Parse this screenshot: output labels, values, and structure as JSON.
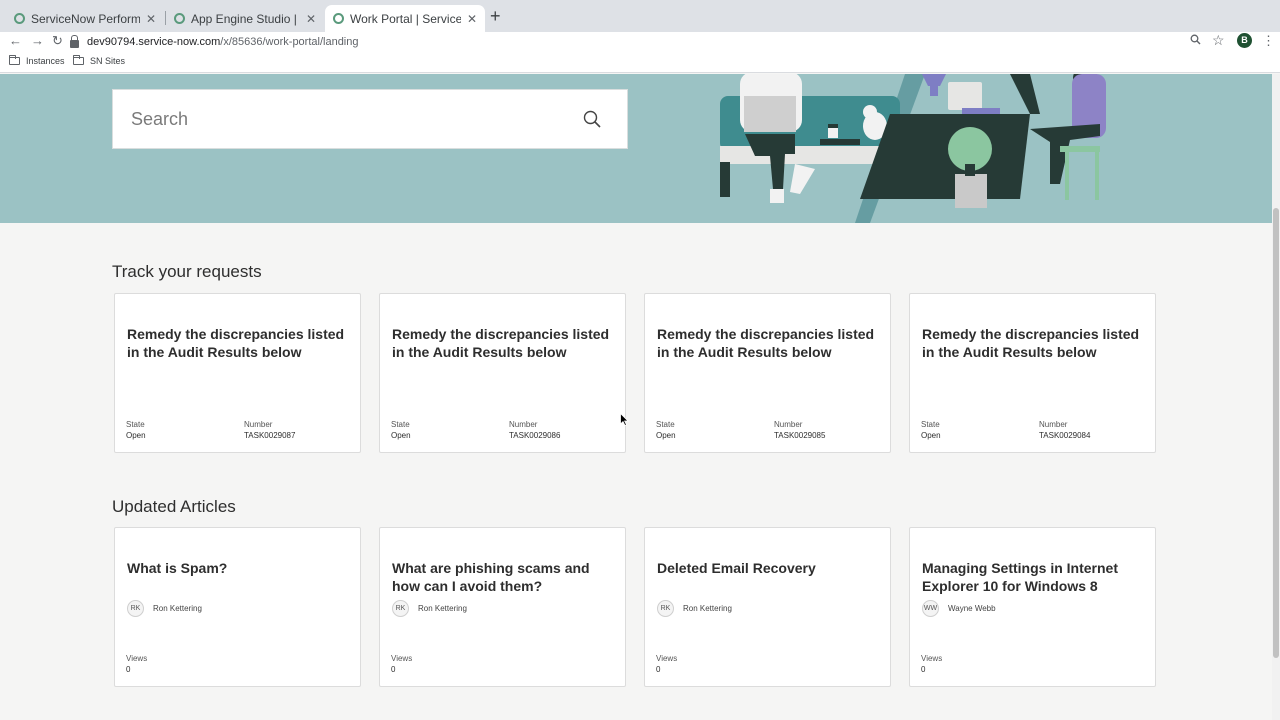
{
  "browser": {
    "tabs": [
      {
        "label": "ServiceNow Performance | Se",
        "active": false
      },
      {
        "label": "App Engine Studio | ServiceNo",
        "active": false
      },
      {
        "label": "Work Portal | ServiceNow",
        "active": true
      }
    ],
    "url_host": "dev90794.service-now.com",
    "url_path": "/x/85636/work-portal/landing",
    "profile_initial": "B",
    "bookmarks": [
      {
        "label": "Instances"
      },
      {
        "label": "SN Sites"
      }
    ]
  },
  "hero": {
    "search_placeholder": "Search",
    "background_color": "#9bc2c4"
  },
  "requests": {
    "title": "Track your requests",
    "state_label": "State",
    "number_label": "Number",
    "items": [
      {
        "title": "Remedy the discrepancies listed in the Audit Results below",
        "state": "Open",
        "number": "TASK0029087"
      },
      {
        "title": "Remedy the discrepancies listed in the Audit Results below",
        "state": "Open",
        "number": "TASK0029086"
      },
      {
        "title": "Remedy the discrepancies listed in the Audit Results below",
        "state": "Open",
        "number": "TASK0029085"
      },
      {
        "title": "Remedy the discrepancies listed in the Audit Results below",
        "state": "Open",
        "number": "TASK0029084"
      }
    ]
  },
  "articles": {
    "title": "Updated Articles",
    "views_label": "Views",
    "items": [
      {
        "title": "What is Spam?",
        "initials": "RK",
        "author": "Ron Kettering",
        "views": "0"
      },
      {
        "title": "What are phishing scams and how can I avoid them?",
        "initials": "RK",
        "author": "Ron Kettering",
        "views": "0"
      },
      {
        "title": "Deleted Email Recovery",
        "initials": "RK",
        "author": "Ron Kettering",
        "views": "0"
      },
      {
        "title": "Managing Settings in Internet Explorer 10 for Windows 8",
        "initials": "WW",
        "author": "Wayne Webb",
        "views": "0"
      }
    ]
  }
}
